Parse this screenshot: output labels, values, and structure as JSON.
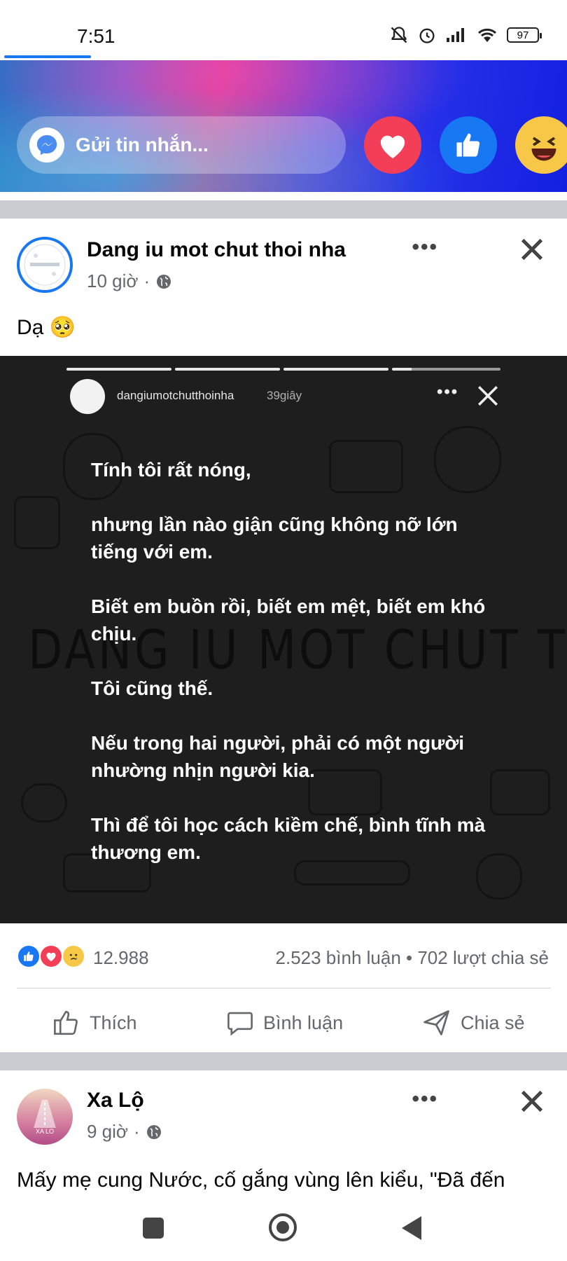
{
  "status": {
    "time": "7:51",
    "battery": "97"
  },
  "composer": {
    "placeholder": "Gửi tin nhắn..."
  },
  "post1": {
    "author": "Dang iu mot chut thoi nha",
    "time": "10 giờ",
    "separator": "·",
    "caption": "Dạ 🥺",
    "story": {
      "username": "dangiumotchutthoinha",
      "time": "39giây",
      "paragraphs": [
        "Tính tôi rất nóng,",
        "nhưng lần nào giận cũng không nỡ lớn tiếng với em.",
        "Biết em buồn rồi, biết em mệt, biết em khó chịu.",
        "Tôi cũng thế.",
        "Nếu trong hai người, phải có một người nhường nhịn người kia.",
        "Thì để tôi học cách kiềm chế, bình tĩnh mà thương em."
      ],
      "watermark": "DANG IU MOT CHUT THOI NHA"
    },
    "reaction_count": "12.988",
    "stats": "2.523 bình luận • 702 lượt chia sẻ",
    "actions": {
      "like": "Thích",
      "comment": "Bình luận",
      "share": "Chia sẻ"
    }
  },
  "post2": {
    "author": "Xa Lộ",
    "avatar_text": "XA LO",
    "time": "9 giờ",
    "separator": "·",
    "text": "Mấy mẹ cung Nước, cố gắng vùng lên kiểu, \"Đã đến"
  },
  "colors": {
    "brand_blue": "#1877f2",
    "like_red": "#f33e58",
    "meta_gray": "#65676b"
  }
}
